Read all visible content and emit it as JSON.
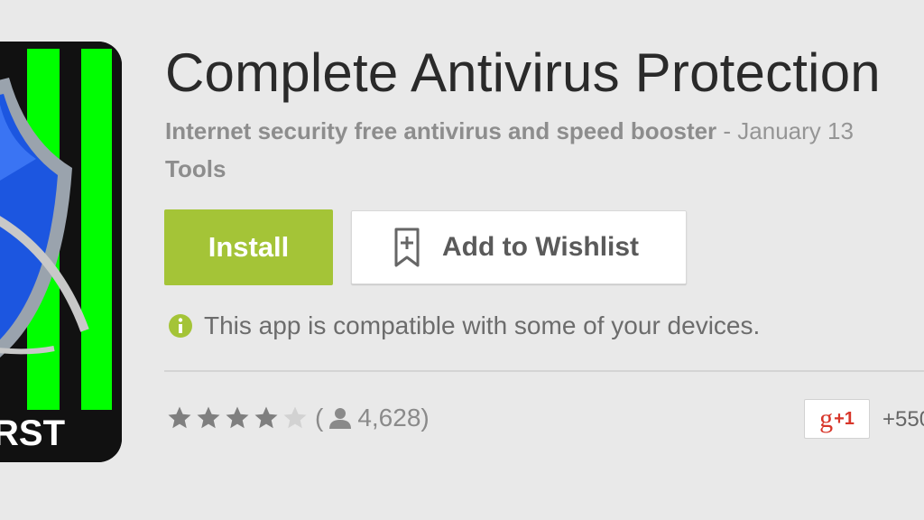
{
  "app": {
    "title": "Complete Antivirus Protection",
    "developer": "Internet security free antivirus and speed booster",
    "separator": " - ",
    "date": "January 13",
    "category": "Tools",
    "icon_text": "RST"
  },
  "actions": {
    "install_label": "Install",
    "wishlist_label": "Add to Wishlist"
  },
  "compatibility": {
    "text": "This app is compatible with some of your devices."
  },
  "rating": {
    "stars_filled": 4,
    "stars_total": 5,
    "open_paren": "(",
    "count": "4,628",
    "close_paren": ")"
  },
  "social": {
    "g": "g",
    "plus_one": "+1",
    "count": "+550"
  },
  "colors": {
    "install": "#a4c437",
    "icon_stripe": "#00ff00",
    "shield": "#1c56e0",
    "gplus": "#d8362a"
  }
}
